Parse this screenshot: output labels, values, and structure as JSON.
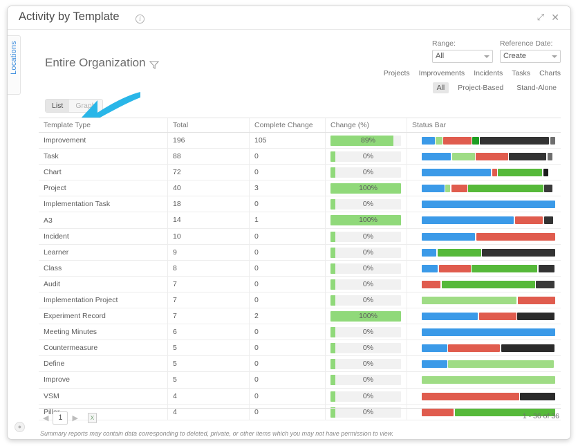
{
  "window": {
    "title": "Activity by Template",
    "info_icon": "info-icon",
    "expand_icon": "expand-icon",
    "expand_glyph": "⤢",
    "close_icon": "close-icon",
    "close_glyph": "✕",
    "corner_glyph": "●"
  },
  "side_tab": {
    "label": "Locations"
  },
  "filters": {
    "range_label": "Range:",
    "range_value": "All",
    "reference_label": "Reference Date:",
    "reference_value": "Create",
    "type_tabs": [
      "Projects",
      "Improvements",
      "Incidents",
      "Tasks",
      "Charts"
    ],
    "scope_tabs": [
      "All",
      "Project-Based",
      "Stand-Alone"
    ],
    "scope_selected": "All"
  },
  "heading": {
    "org": "Entire Organization",
    "funnel_icon": "funnel-filter-icon"
  },
  "view_toggle": {
    "list": "List",
    "graph": "Graph",
    "selected": "List"
  },
  "table": {
    "columns": [
      "Template Type",
      "Total",
      "Complete Change",
      "Change (%)",
      "Status Bar"
    ],
    "rows": [
      {
        "name": "Improvement",
        "total": "196",
        "complete": "105",
        "pct": "89%",
        "pct_value": 89,
        "segments": [
          {
            "c": "#3b9ae8",
            "w": 10
          },
          {
            "c": "#9fdc85",
            "w": 5
          },
          {
            "c": "#e05c4e",
            "w": 22
          },
          {
            "c": "#1e9e22",
            "w": 5
          },
          {
            "c": "#333333",
            "w": 55
          },
          {
            "c": "#6e6e6e",
            "w": 1.5
          }
        ]
      },
      {
        "name": "Task",
        "total": "88",
        "complete": "0",
        "pct": "0%",
        "pct_value": 0,
        "segments": [
          {
            "c": "#3b9ae8",
            "w": 22
          },
          {
            "c": "#9fdc85",
            "w": 17
          },
          {
            "c": "#e05c4e",
            "w": 24
          },
          {
            "c": "#333333",
            "w": 28
          },
          {
            "c": "#6e6e6e",
            "w": 4
          }
        ]
      },
      {
        "name": "Chart",
        "total": "72",
        "complete": "0",
        "pct": "0%",
        "pct_value": 0,
        "segments": [
          {
            "c": "#3b9ae8",
            "w": 52
          },
          {
            "c": "#e05c4e",
            "w": 3
          },
          {
            "c": "#56b93a",
            "w": 33
          },
          {
            "c": "#1c1c1c",
            "w": 2
          }
        ]
      },
      {
        "name": "Project",
        "total": "40",
        "complete": "3",
        "pct": "100%",
        "pct_value": 100,
        "segments": [
          {
            "c": "#3b9ae8",
            "w": 17
          },
          {
            "c": "#9fdc85",
            "w": 2
          },
          {
            "c": "#e05c4e",
            "w": 12
          },
          {
            "c": "#56b93a",
            "w": 56
          },
          {
            "c": "#3a3a3a",
            "w": 6
          }
        ]
      },
      {
        "name": "Implementation Task",
        "total": "18",
        "complete": "0",
        "pct": "0%",
        "pct_value": 0,
        "segments": [
          {
            "c": "#3b9ae8",
            "w": 100
          }
        ]
      },
      {
        "name": "A3",
        "total": "14",
        "complete": "1",
        "pct": "100%",
        "pct_value": 100,
        "segments": [
          {
            "c": "#3b9ae8",
            "w": 69
          },
          {
            "c": "#e05c4e",
            "w": 21
          },
          {
            "c": "#333333",
            "w": 7
          }
        ]
      },
      {
        "name": "Incident",
        "total": "10",
        "complete": "0",
        "pct": "0%",
        "pct_value": 0,
        "segments": [
          {
            "c": "#3b9ae8",
            "w": 40
          },
          {
            "c": "#e05c4e",
            "w": 59
          }
        ]
      },
      {
        "name": "Learner",
        "total": "9",
        "complete": "0",
        "pct": "0%",
        "pct_value": 0,
        "segments": [
          {
            "c": "#3b9ae8",
            "w": 11
          },
          {
            "c": "#56b93a",
            "w": 33
          },
          {
            "c": "#333333",
            "w": 55
          }
        ]
      },
      {
        "name": "Class",
        "total": "8",
        "complete": "0",
        "pct": "0%",
        "pct_value": 0,
        "segments": [
          {
            "c": "#3b9ae8",
            "w": 12
          },
          {
            "c": "#e05c4e",
            "w": 24
          },
          {
            "c": "#56b93a",
            "w": 49
          },
          {
            "c": "#333333",
            "w": 12
          }
        ]
      },
      {
        "name": "Audit",
        "total": "7",
        "complete": "0",
        "pct": "0%",
        "pct_value": 0,
        "segments": [
          {
            "c": "#e05c4e",
            "w": 14
          },
          {
            "c": "#56b93a",
            "w": 70
          },
          {
            "c": "#3a3a3a",
            "w": 14
          }
        ]
      },
      {
        "name": "Implementation Project",
        "total": "7",
        "complete": "0",
        "pct": "0%",
        "pct_value": 0,
        "segments": [
          {
            "c": "#9fdc85",
            "w": 71
          },
          {
            "c": "#e05c4e",
            "w": 28
          }
        ]
      },
      {
        "name": "Experiment Record",
        "total": "7",
        "complete": "2",
        "pct": "100%",
        "pct_value": 100,
        "segments": [
          {
            "c": "#3b9ae8",
            "w": 42
          },
          {
            "c": "#e05c4e",
            "w": 28
          },
          {
            "c": "#2b2b2b",
            "w": 28
          }
        ]
      },
      {
        "name": "Meeting Minutes",
        "total": "6",
        "complete": "0",
        "pct": "0%",
        "pct_value": 0,
        "segments": [
          {
            "c": "#3b9ae8",
            "w": 100
          }
        ]
      },
      {
        "name": "Countermeasure",
        "total": "5",
        "complete": "0",
        "pct": "0%",
        "pct_value": 0,
        "segments": [
          {
            "c": "#3b9ae8",
            "w": 19
          },
          {
            "c": "#e05c4e",
            "w": 39
          },
          {
            "c": "#2b2b2b",
            "w": 40
          }
        ]
      },
      {
        "name": "Define",
        "total": "5",
        "complete": "0",
        "pct": "0%",
        "pct_value": 0,
        "segments": [
          {
            "c": "#3b9ae8",
            "w": 19
          },
          {
            "c": "#9fdc85",
            "w": 79
          }
        ]
      },
      {
        "name": "Improve",
        "total": "5",
        "complete": "0",
        "pct": "0%",
        "pct_value": 0,
        "segments": [
          {
            "c": "#9fdc85",
            "w": 100
          }
        ]
      },
      {
        "name": "VSM",
        "total": "4",
        "complete": "0",
        "pct": "0%",
        "pct_value": 0,
        "segments": [
          {
            "c": "#e05c4e",
            "w": 73
          },
          {
            "c": "#2b2b2b",
            "w": 26
          }
        ]
      },
      {
        "name": "Pillar",
        "total": "4",
        "complete": "0",
        "pct": "0%",
        "pct_value": 0,
        "segments": [
          {
            "c": "#e05c4e",
            "w": 24
          },
          {
            "c": "#56b93a",
            "w": 75
          }
        ]
      }
    ]
  },
  "footer": {
    "prev_glyph": "◀",
    "next_glyph": "▶",
    "page": "1",
    "export_icon": "export-excel-icon",
    "export_glyph": "X",
    "count": "1 - 36 of 36",
    "note": "Summary reports may contain data corresponding to deleted, private, or other items which you may not have permission to view."
  }
}
